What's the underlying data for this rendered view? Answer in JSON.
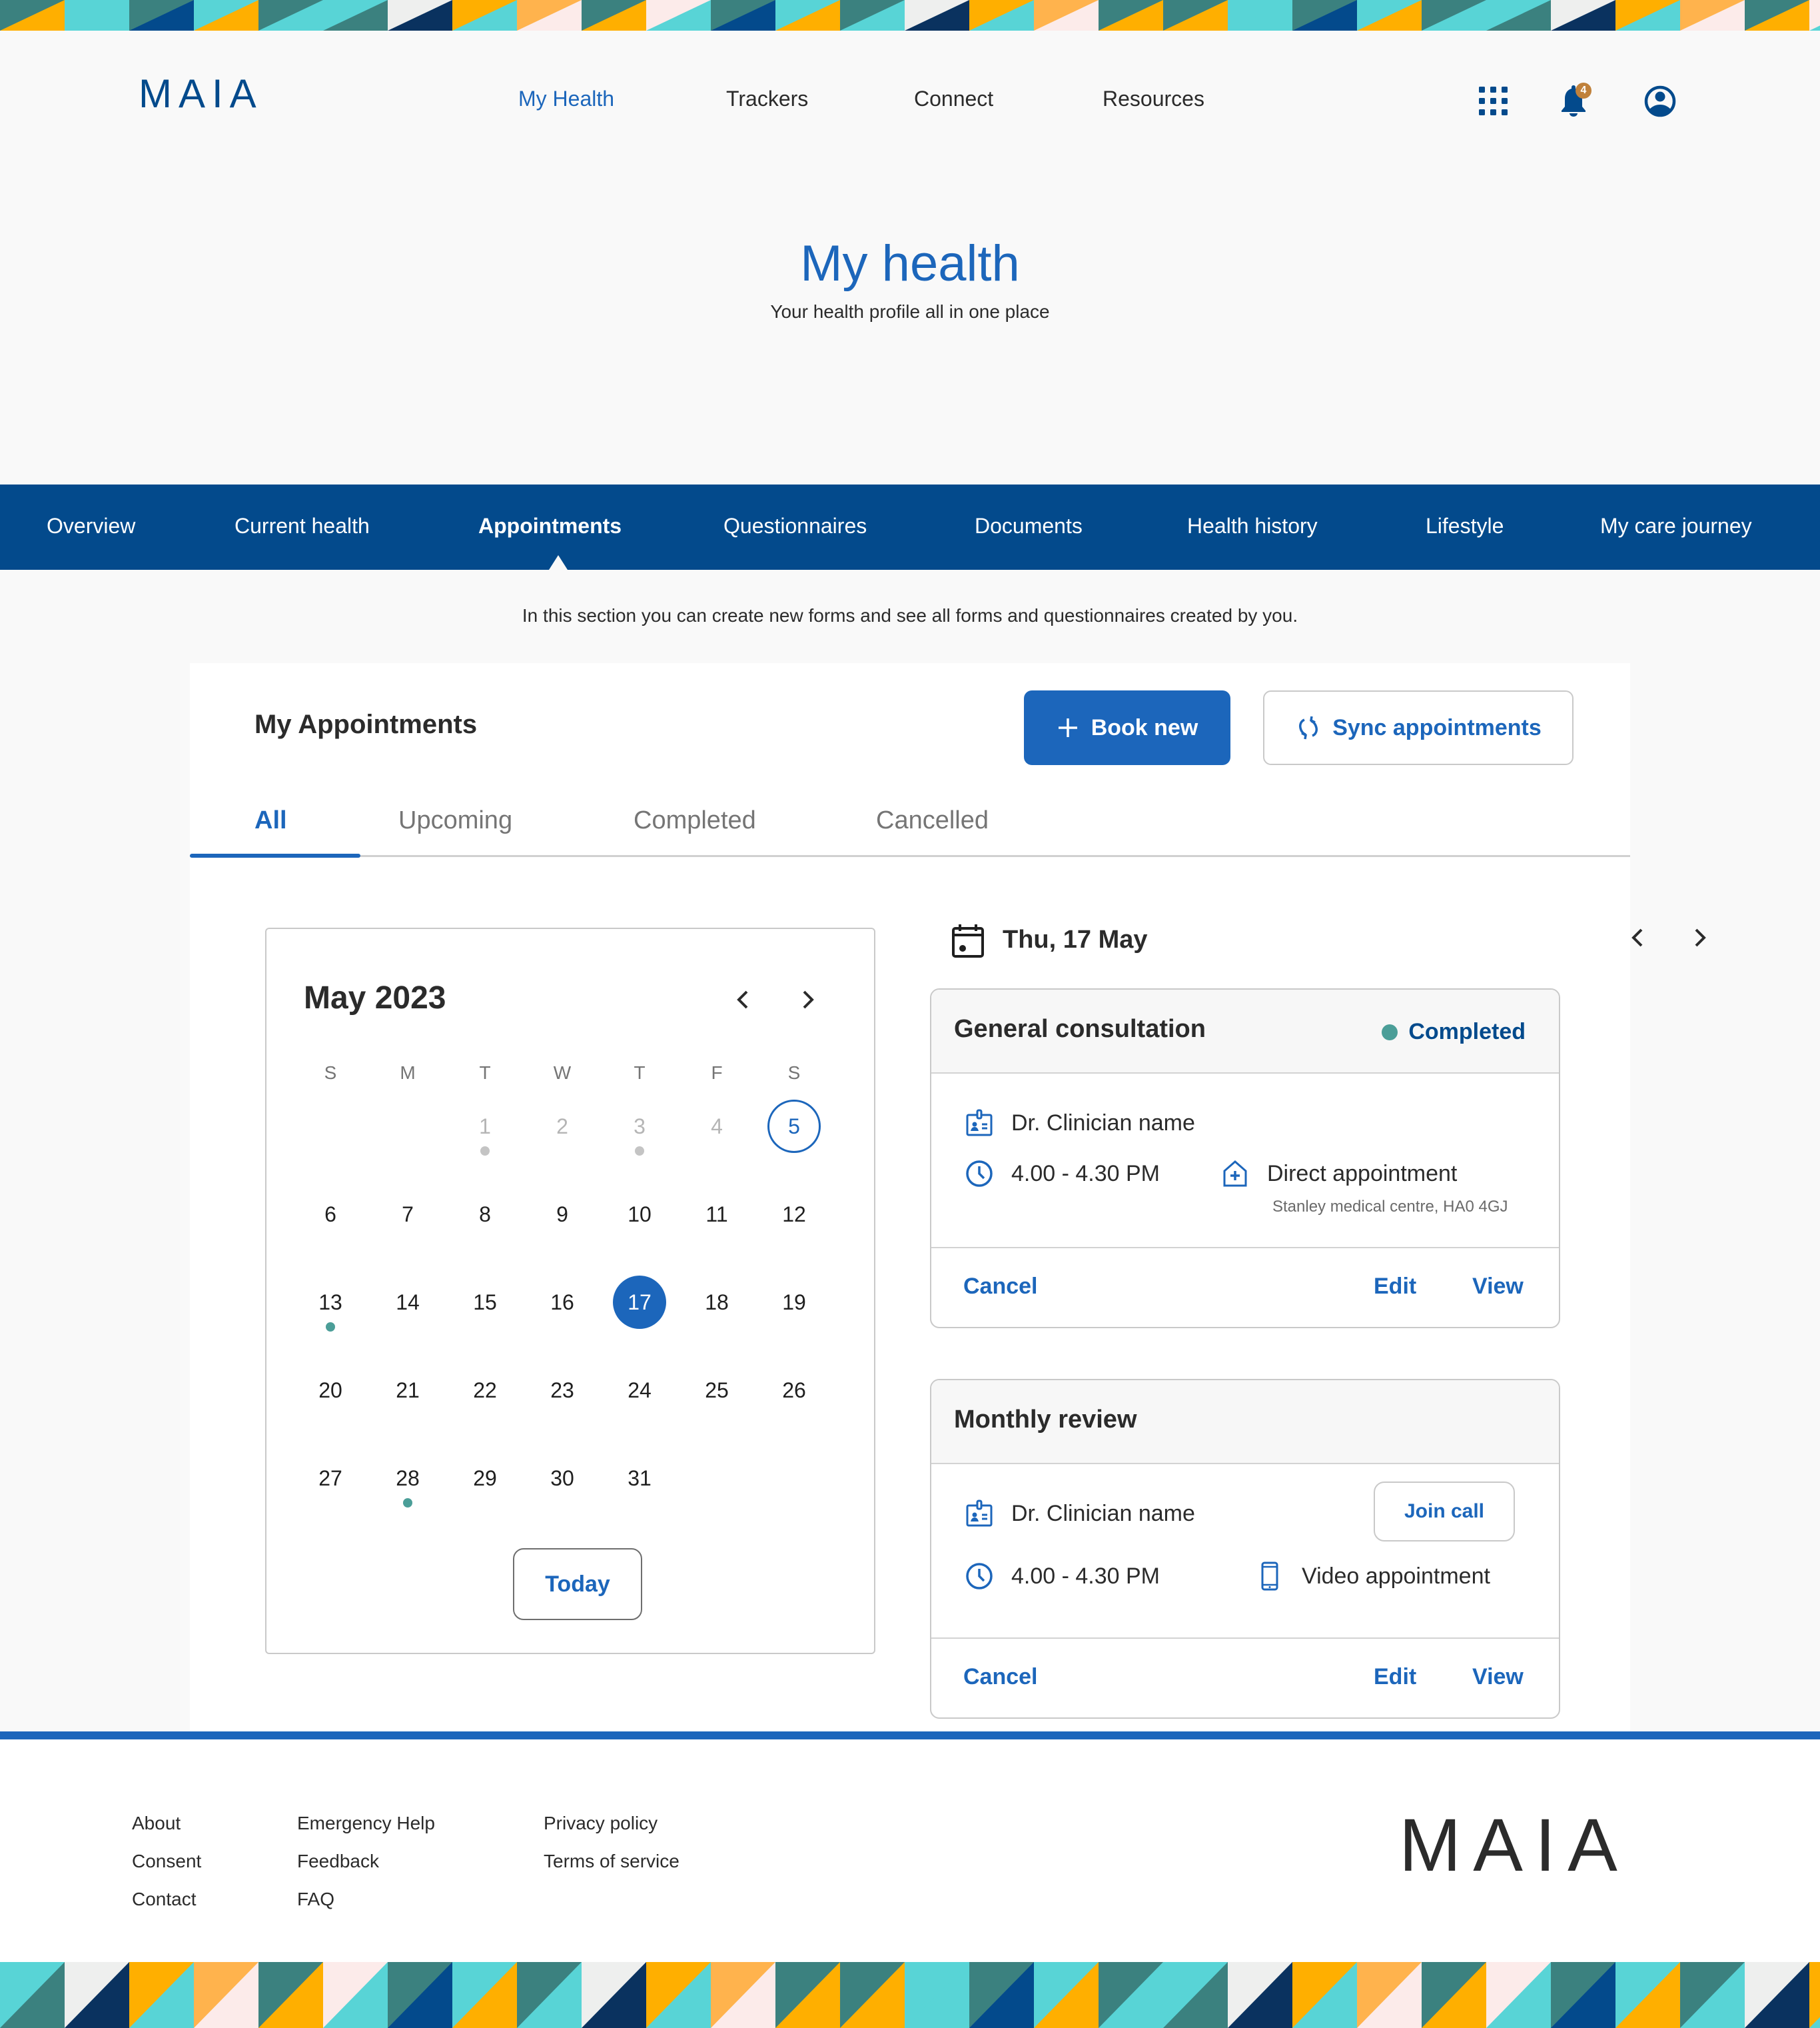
{
  "brand": {
    "logo": "MAIA",
    "primary": "#1c66bb",
    "navy": "#034a8c",
    "teal": "#4b9e98",
    "badge": "#c0813b"
  },
  "topnav": {
    "items": [
      {
        "label": "My Health",
        "active": true
      },
      {
        "label": "Trackers",
        "active": false
      },
      {
        "label": "Connect",
        "active": false
      },
      {
        "label": "Resources",
        "active": false
      }
    ],
    "icons": {
      "apps": "apps-grid-icon",
      "notifications": "bell-icon",
      "account": "account-circle-icon"
    },
    "notification_count": "4"
  },
  "hero": {
    "title": "My health",
    "subtitle": "Your health profile all in one place"
  },
  "section_nav": {
    "tabs": [
      {
        "label": "Overview",
        "active": false
      },
      {
        "label": "Current health",
        "active": false
      },
      {
        "label": "Appointments",
        "active": true
      },
      {
        "label": "Questionnaires",
        "active": false
      },
      {
        "label": "Documents",
        "active": false
      },
      {
        "label": "Health history",
        "active": false
      },
      {
        "label": "Lifestyle",
        "active": false
      },
      {
        "label": "My care journey",
        "active": false
      }
    ]
  },
  "intro": "In this section you can create new forms and see all forms and questionnaires created by you.",
  "appointments": {
    "title": "My Appointments",
    "book_new": "Book new",
    "sync": "Sync appointments",
    "filter_tabs": [
      {
        "label": "All",
        "active": true
      },
      {
        "label": "Upcoming",
        "active": false
      },
      {
        "label": "Completed",
        "active": false
      },
      {
        "label": "Cancelled",
        "active": false
      }
    ]
  },
  "calendar": {
    "month_label": "May 2023",
    "weekdays": [
      "S",
      "M",
      "T",
      "W",
      "T",
      "F",
      "S"
    ],
    "first_weekday_index": 2,
    "days_in_month": 31,
    "muted_days": [
      1,
      2,
      3,
      4
    ],
    "outlined_day": 5,
    "selected_day": 17,
    "dots": [
      {
        "day": 1,
        "color": "#c4c4c4"
      },
      {
        "day": 3,
        "color": "#c4c4c4"
      },
      {
        "day": 13,
        "color": "#4b9e98"
      },
      {
        "day": 28,
        "color": "#4b9e98"
      }
    ],
    "today_button": "Today"
  },
  "day_view": {
    "label": "Thu, 17 May",
    "cards": [
      {
        "title": "General consultation",
        "status": "Completed",
        "clinician": "Dr. Clinician name",
        "time": "4.00 - 4.30 PM",
        "type": "Direct appointment",
        "location": "Stanley medical centre, HA0 4GJ",
        "actions": {
          "cancel": "Cancel",
          "edit": "Edit",
          "view": "View"
        }
      },
      {
        "title": "Monthly review",
        "clinician": "Dr. Clinician name",
        "join_call": "Join call",
        "time": "4.00 - 4.30 PM",
        "type": "Video appointment",
        "actions": {
          "cancel": "Cancel",
          "edit": "Edit",
          "view": "View"
        }
      }
    ]
  },
  "footer": {
    "columns": [
      [
        "About",
        "Consent",
        "Contact"
      ],
      [
        "Emergency Help",
        "Feedback",
        "FAQ"
      ],
      [
        "Privacy policy",
        "Terms of service"
      ]
    ],
    "logo": "MAIA"
  },
  "pattern_colors": [
    "#3b817f",
    "#58d4d6",
    "#034a8c",
    "#ffaf00",
    "#ffb34d",
    "#fcebea",
    "#eeefee",
    "#0a325f"
  ]
}
